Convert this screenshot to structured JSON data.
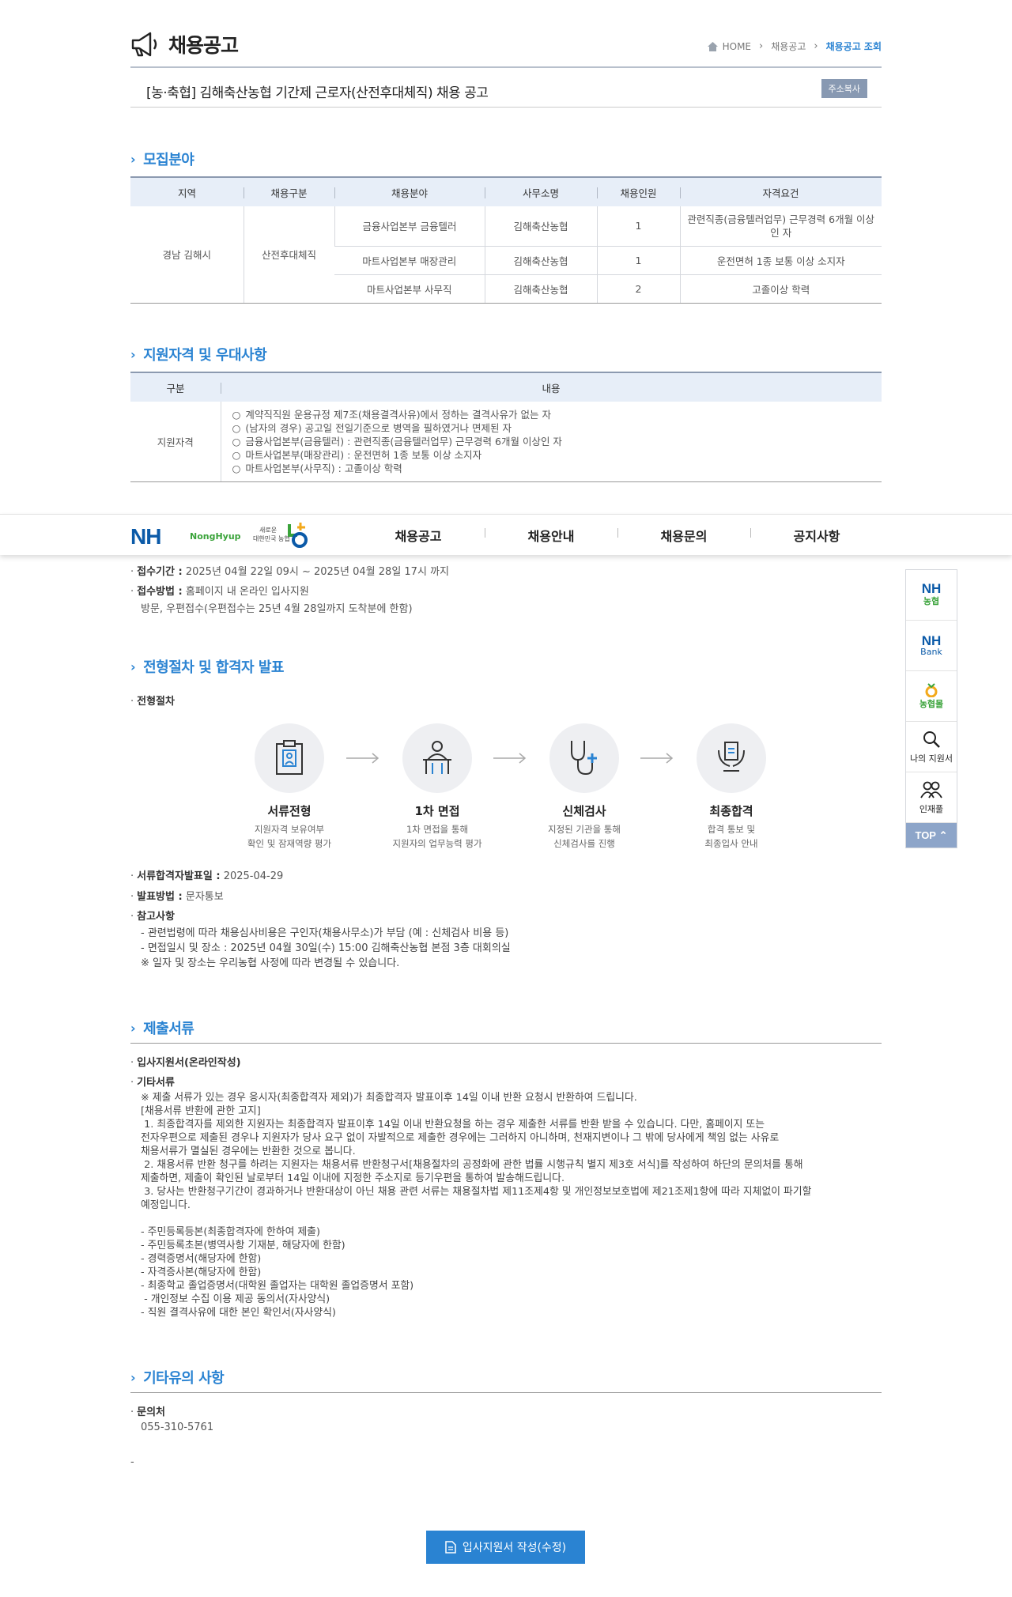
{
  "header": {
    "title": "채용공고",
    "breadcrumb": [
      "HOME",
      "채용공고",
      "채용공고 조회"
    ]
  },
  "notice": {
    "title": "[농·축협] 김해축산농협 기간제 근로자(산전후대체직) 채용 공고",
    "copy_button": "주소복사"
  },
  "sections": {
    "recruit": "모집분야",
    "qualification": "지원자격 및 우대사항",
    "process": "전형절차 및 합격자 발표",
    "documents": "제출서류",
    "other": "기타유의 사항"
  },
  "recruit_table": {
    "headers": [
      "지역",
      "채용구분",
      "채용분야",
      "사무소명",
      "채용인원",
      "자격요건"
    ],
    "region": "경남 김해시",
    "type": "산전후대체직",
    "rows": [
      {
        "field": "금융사업본부 금융텔러",
        "office": "김해축산농협",
        "count": "1",
        "req": "관련직종(금융텔러업무) 근무경력 6개월 이상인 자"
      },
      {
        "field": "마트사업본부 매장관리",
        "office": "김해축산농협",
        "count": "1",
        "req": "운전면허 1종 보통 이상 소지자"
      },
      {
        "field": "마트사업본부 사무직",
        "office": "김해축산농협",
        "count": "2",
        "req": "고졸이상 학력"
      }
    ]
  },
  "qual_table": {
    "headers": [
      "구분",
      "내용"
    ],
    "label": "지원자격",
    "items": [
      "계약직직원 운용규정 제7조(채용결격사유)에서 정하는 결격사유가 없는 자",
      "(남자의 경우) 공고일 전일기준으로 병역을 필하였거나 면제된 자",
      "금융사업본부(금융텔러) : 관련직종(금융텔러업무) 근무경력 6개월 이상인 자",
      "마트사업본부(매장관리) : 운전면허 1종 보통 이상 소지자",
      "마트사업본부(사무직) : 고졸이상 학력"
    ]
  },
  "gnb": {
    "brand": "NH",
    "brand_text": "NongHyup",
    "slogan1": "새로운",
    "slogan2": "대한민국 농협",
    "menu": [
      "채용공고",
      "채용안내",
      "채용문의",
      "공지사항"
    ]
  },
  "reception": {
    "period_label": "접수기간 :",
    "period": "2025년 04월 22일 09시 ~ 2025년 04월 28일 17시 까지",
    "method_label": "접수방법 :",
    "method": "홈페이지 내 온라인 입사지원",
    "method2": "방문, 우편접수(우편접수는 25년 4월 28일까지 도착분에 한함)"
  },
  "process": {
    "label": "전형절차",
    "steps": [
      {
        "name": "서류전형",
        "desc1": "지원자격 보유여부",
        "desc2": "확인 및 잠재역량 평가"
      },
      {
        "name": "1차 면접",
        "desc1": "1차 면접을 통해",
        "desc2": "지원자의 업무능력 평가"
      },
      {
        "name": "신체검사",
        "desc1": "지정된 기관을 통해",
        "desc2": "신체검사를 진행"
      },
      {
        "name": "최종합격",
        "desc1": "합격 통보 및",
        "desc2": "최종입사 안내"
      }
    ],
    "announce_label": "서류합격자발표일 :",
    "announce_date": "2025-04-29",
    "method_label": "발표방법 :",
    "method": "문자통보",
    "ref_label": "참고사항",
    "refs": [
      "- 관련법령에 따라 채용심사비용은 구인자(채용사무소)가 부담 (예 : 신체검사 비용 등)",
      "- 면접일시 및 장소 : 2025년 04월 30일(수) 15:00 김해축산농협 본점 3층 대회의실",
      "※ 일자 및 장소는 우리농협 사정에 따라 변경될 수 있습니다."
    ]
  },
  "documents": {
    "item1": "입사지원서(온라인작성)",
    "item2": "기타서류",
    "text": [
      "※ 제출 서류가 있는 경우 응시자(최종합격자 제외)가 최종합격자 발표이후 14일 이내 반환 요청시 반환하여 드립니다.",
      "[채용서류 반환에 관한 고지]",
      " 1. 최종합격자를 제외한 지원자는 최종합격자 발표이후 14일 이내 반환요청을 하는 경우 제출한 서류를 반환 받을 수 있습니다. 다만, 홈페이지 또는",
      "전자우편으로 제출된 경우나 지원자가 당사 요구 없이 자발적으로 제출한 경우에는 그러하지 아니하며, 천재지변이나 그 밖에 당사에게 책임 없는 사유로",
      "채용서류가 멸실된 경우에는 반환한 것으로 봅니다.",
      " 2. 채용서류 반환 청구를 하려는 지원자는 채용서류 반환청구서[채용절차의 공정화에 관한 법률 시행규칙 별지 제3호 서식]를 작성하여 하단의 문의처를 통해",
      "제출하면, 제출이 확인된 날로부터 14일 이내에 지정한 주소지로 등기우편을 통하여 발송해드립니다.",
      " 3. 당사는 반환청구기간이 경과하거나 반환대상이 아닌 채용 관련 서류는 채용절차법 제11조제4항 및 개인정보보호법에 제21조제1항에 따라 지체없이 파기할",
      "예정입니다.",
      "",
      "- 주민등록등본(최종합격자에 한하여 제출)",
      "- 주민등록초본(병역사항 기재분, 해당자에 한함)",
      "- 경력증명서(해당자에 한함)",
      "- 자격증사본(해당자에 한함)",
      "- 최종학교 졸업증명서(대학원 졸업자는 대학원 졸업증명서 포함)",
      " - 개인정보 수집 이용 제공 동의서(자사양식)",
      "- 직원 결격사유에 대한 본인 확인서(자사양식)"
    ]
  },
  "other": {
    "contact_label": "문의처",
    "contact": "055-310-5761",
    "blank": "-"
  },
  "quick": {
    "items": [
      {
        "top": "NH",
        "sub": "농협"
      },
      {
        "top": "NH",
        "sub": "Bank"
      },
      {
        "sub": "농협몰"
      },
      {
        "label": "나의 지원서"
      },
      {
        "label": "인재풀"
      }
    ],
    "top_button": "TOP"
  },
  "apply_button": "입사지원서 작성(수정)"
}
